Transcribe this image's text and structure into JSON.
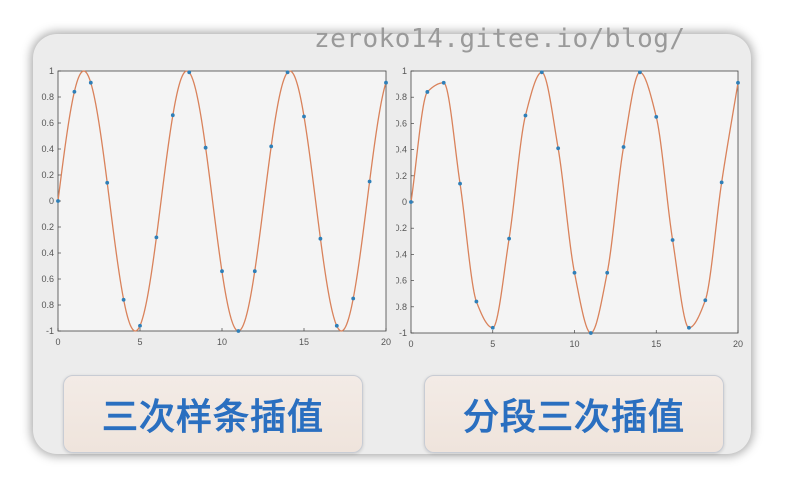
{
  "watermark": "zeroko14.gitee.io/blog/",
  "labels": {
    "left": "三次样条插值",
    "right": "分段三次插值"
  },
  "colors": {
    "curve": "#d9825b",
    "point": "#2e7fb8",
    "label": "#2a6fc0"
  },
  "chart_data": [
    {
      "type": "line",
      "method": "cubic spline interpolation",
      "xlim": [
        0,
        20
      ],
      "ylim": [
        -1,
        1
      ],
      "xticks": [
        0,
        5,
        10,
        15,
        20
      ],
      "yticks": [
        1,
        0.8,
        0.6,
        0.4,
        0.2,
        0,
        -0.2,
        -0.4,
        -0.6,
        -0.8,
        -1
      ],
      "yticklabels": [
        "1",
        "0.8",
        "0.6",
        "0.4",
        "0.2",
        "0",
        "0.2",
        "0.4",
        "0.6",
        "0.8",
        "-1"
      ],
      "series": [
        {
          "kind": "points",
          "x": [
            0,
            1,
            2,
            3,
            4,
            5,
            6,
            7,
            8,
            9,
            10,
            11,
            12,
            13,
            14,
            15,
            16,
            17,
            18,
            19,
            20
          ],
          "y": [
            0,
            0.84,
            0.91,
            0.14,
            -0.76,
            -0.96,
            -0.28,
            0.66,
            0.99,
            0.41,
            -0.54,
            -1.0,
            -0.54,
            0.42,
            0.99,
            0.65,
            -0.29,
            -0.96,
            -0.75,
            0.15,
            0.91
          ]
        },
        {
          "kind": "curve",
          "function": "sin(x)",
          "domain": [
            0,
            20
          ]
        }
      ]
    },
    {
      "type": "line",
      "method": "piecewise cubic interpolation",
      "xlim": [
        0,
        20
      ],
      "ylim": [
        -1,
        1
      ],
      "xticks": [
        0,
        5,
        10,
        15,
        20
      ],
      "yticks": [
        1,
        0.8,
        0.6,
        0.4,
        0.2,
        0,
        -0.2,
        -0.4,
        -0.6,
        -0.8,
        -1
      ],
      "yticklabels": [
        "1",
        "0.8",
        "0.6",
        "0.4",
        "0.2",
        "0",
        "0.2",
        "0.4",
        "0.6",
        "0.8",
        "-1"
      ],
      "series": [
        {
          "kind": "points",
          "x": [
            0,
            1,
            2,
            3,
            4,
            5,
            6,
            7,
            8,
            9,
            10,
            11,
            12,
            13,
            14,
            15,
            16,
            17,
            18,
            19,
            20
          ],
          "y": [
            0,
            0.84,
            0.91,
            0.14,
            -0.76,
            -0.96,
            -0.28,
            0.66,
            0.99,
            0.41,
            -0.54,
            -1.0,
            -0.54,
            0.42,
            0.99,
            0.65,
            -0.29,
            -0.96,
            -0.75,
            0.15,
            0.91
          ]
        },
        {
          "kind": "curve",
          "interpolation": "pchip"
        }
      ]
    }
  ]
}
